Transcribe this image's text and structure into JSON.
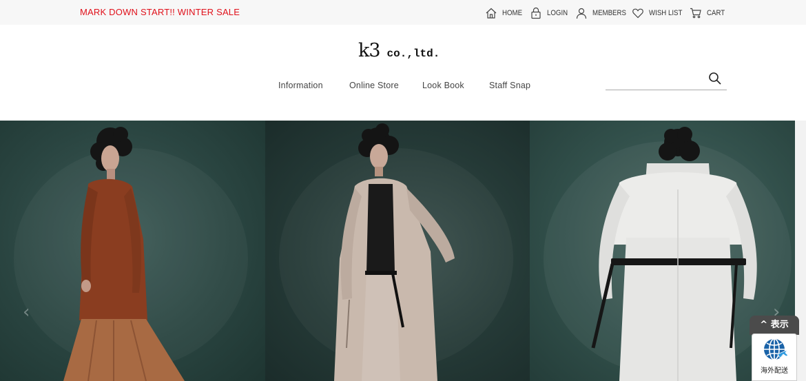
{
  "topbar": {
    "sale_text": "MARK DOWN START!! WINTER SALE",
    "links": {
      "home": "HOME",
      "login": "LOGIN",
      "members": "MEMBERS",
      "wishlist": "WISH LIST",
      "cart": "CART"
    }
  },
  "header": {
    "logo_main": "k3",
    "logo_sub": "co.,ltd."
  },
  "nav": {
    "information": "Information",
    "online_store": "Online Store",
    "look_book": "Look Book",
    "staff_snap": "Staff Snap"
  },
  "search": {
    "value": "",
    "icon": "search-icon"
  },
  "hero": {
    "prev_icon": "‹",
    "next_icon": "›",
    "slides": [
      "rust-top-orange-skirt",
      "beige-trench-coat",
      "white-trench-coat-back"
    ]
  },
  "widget": {
    "tab_label": "表示",
    "label": "海外配送"
  },
  "colors": {
    "sale_red": "#e0101a",
    "topbar_bg": "#f7f7f7",
    "hero_green": "#2a4541",
    "widget_dark": "#4b4b4b",
    "globe_blue": "#1a63a8"
  }
}
